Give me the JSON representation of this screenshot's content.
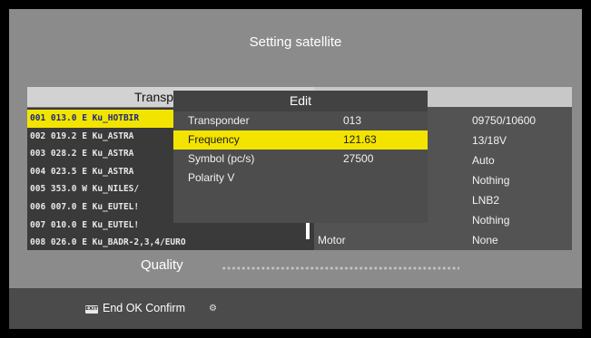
{
  "screen": {
    "title": "Setting satellite"
  },
  "transponder_list": {
    "header": "Transp",
    "rows": [
      "001 013.0 E  Ku_HOTBIR",
      "002 019.2 E  Ku_ASTRA",
      "003 028.2 E  Ku_ASTRA",
      "004 023.5 E  Ku_ASTRA",
      "005 353.0 W  Ku_NILES/",
      "006 007.0 E  Ku_EUTEL!",
      "007 010.0 E  Ku_EUTEL!",
      "008 026.0 E  Ku_BADR-2,3,4/EURO"
    ],
    "selected_index": 0
  },
  "settings": {
    "values": [
      "09750/10600",
      "13/18V",
      "Auto",
      "Nothing",
      "LNB2",
      "Nothing",
      "None"
    ],
    "motor_label": "Motor"
  },
  "edit_dialog": {
    "title": "Edit",
    "rows": [
      {
        "label": "Transponder",
        "value": "013"
      },
      {
        "label": "Frequency",
        "value": "121.63"
      },
      {
        "label": "Symbol (pc/s)",
        "value": "27500"
      },
      {
        "label": "Polarity V",
        "value": ""
      }
    ],
    "selected_index": 1
  },
  "quality": {
    "label": "Quality"
  },
  "footer": {
    "exit_icon_text": "EXIT",
    "text": "End OK Confirm"
  },
  "colors": {
    "highlight": "#f3e400",
    "selected_text": "#1a2a80"
  }
}
